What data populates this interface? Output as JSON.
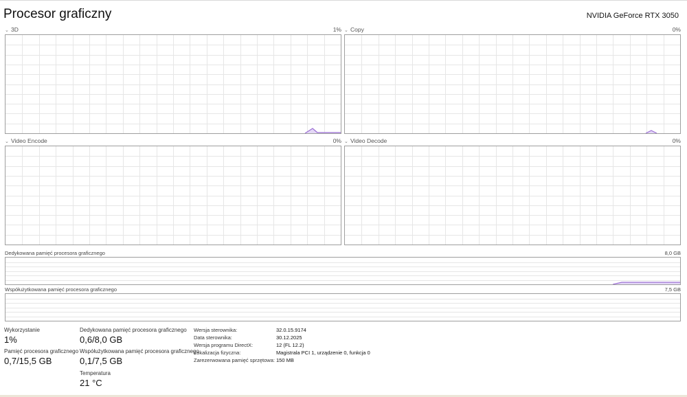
{
  "header": {
    "title": "Procesor graficzny",
    "gpu_name": "NVIDIA GeForce RTX 3050"
  },
  "engines": [
    {
      "name": "3D",
      "usage": "1%"
    },
    {
      "name": "Copy",
      "usage": "0%"
    },
    {
      "name": "Video Encode",
      "usage": "0%"
    },
    {
      "name": "Video Decode",
      "usage": "0%"
    }
  ],
  "memory_graphs": [
    {
      "label": "Dedykowana pamięć procesora graficznego",
      "max": "8,0 GB"
    },
    {
      "label": "Współużytkowana pamięć procesora graficznego",
      "max": "7,5 GB"
    }
  ],
  "stats": {
    "utilization": {
      "label": "Wykorzystanie",
      "value": "1%"
    },
    "gpu_memory": {
      "label": "Pamięć procesora graficznego",
      "value": "0,7/15,5 GB"
    },
    "dedicated_memory": {
      "label": "Dedykowana pamięć procesora graficznego",
      "value": "0,6/8,0 GB"
    },
    "shared_memory": {
      "label": "Współużytkowana pamięć procesora graficznego",
      "value": "0,1/7,5 GB"
    },
    "temperature": {
      "label": "Temperatura",
      "value": "21 °C"
    }
  },
  "info": [
    {
      "key": "Wersja sterownika:",
      "value": "32.0.15.9174"
    },
    {
      "key": "Data sterownika:",
      "value": "30.12.2025"
    },
    {
      "key": "Wersja programu DirectX:",
      "value": "12 (FL 12.2)"
    },
    {
      "key": "Lokalizacja fizyczna:",
      "value": "Magistrala PCI 1, urządzenie 0, funkcja 0"
    },
    {
      "key": "Zarezerwowana pamięć sprzętowa:",
      "value": "150 MB"
    }
  ],
  "colors": {
    "graph_line": "#9c6fd4",
    "graph_fill": "#e4d8f6",
    "grid": "#e6e6e6"
  }
}
